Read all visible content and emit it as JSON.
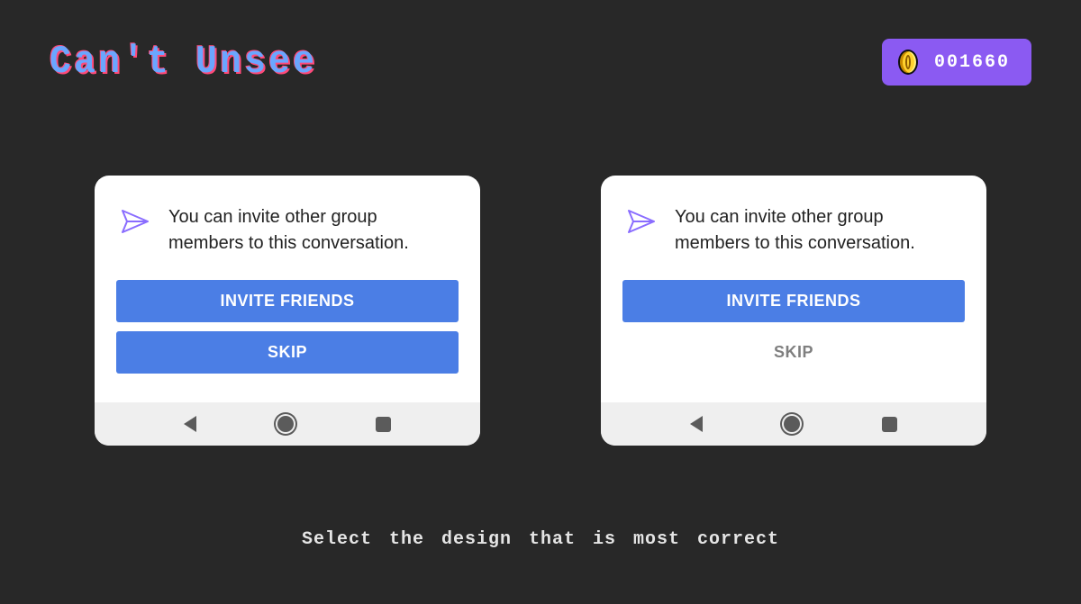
{
  "header": {
    "logo": "Can't Unsee",
    "score": "001660"
  },
  "card": {
    "text": "You can invite other group members to this conversation.",
    "invite_label": "INVITE FRIENDS",
    "skip_label": "SKIP"
  },
  "prompt": "Select the design that is most correct",
  "colors": {
    "bg": "#282828",
    "accent_button": "#4b7ee5",
    "score_badge": "#8b5af2"
  }
}
